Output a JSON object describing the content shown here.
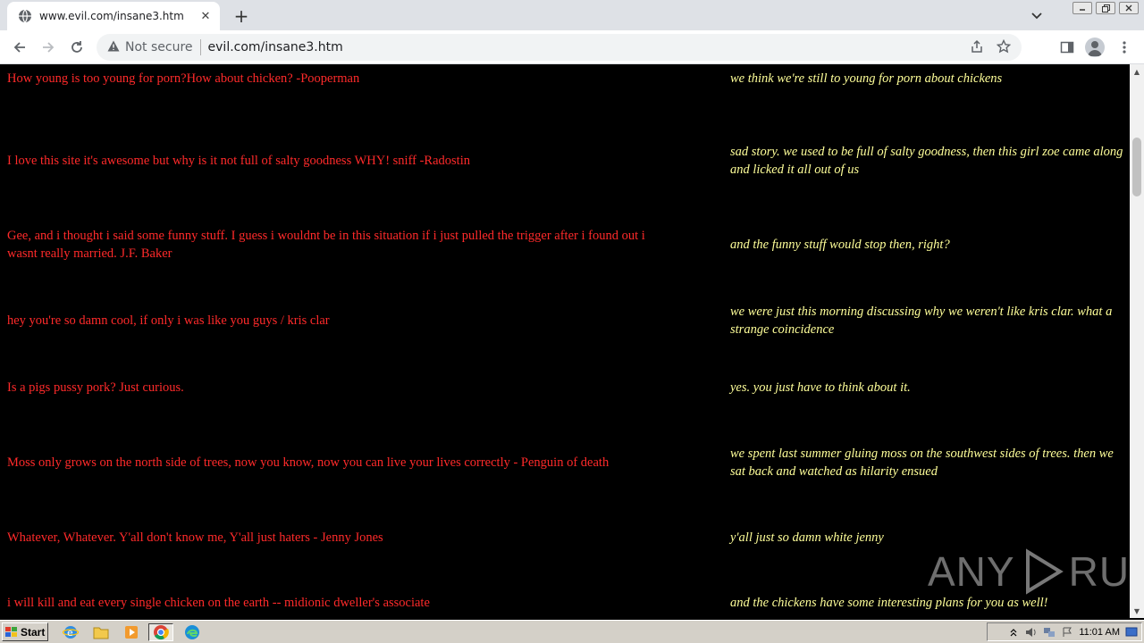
{
  "browser": {
    "tab_title": "www.evil.com/insane3.htm",
    "security_label": "Not secure",
    "url": "evil.com/insane3.htm",
    "new_tab_symbol": "+",
    "close_symbol": "✕"
  },
  "rows": [
    {
      "left": "How young is too young for porn?How about chicken? -Pooperman",
      "right": "we think we're still to young for porn about chickens"
    },
    {
      "left": "I love this site it's awesome but why is it not full of salty goodness WHY! sniff -Radostin",
      "right": "sad story.  we used to be full of salty goodness, then this girl zoe came along and licked it all out of us"
    },
    {
      "left": "Gee, and i thought i said some funny stuff. I guess i wouldnt be in this situation if i just pulled the trigger after i found out i wasnt really married. J.F. Baker",
      "right": "and the funny stuff would stop then, right?"
    },
    {
      "left": "hey you're so damn cool, if only i was like you guys / kris clar",
      "right": "we were just this morning discussing why we weren't like kris clar. what a strange coincidence"
    },
    {
      "left": "Is a pigs pussy pork? Just curious.",
      "right": "yes.  you just have to think about it."
    },
    {
      "left": "Moss only grows on the north side of trees, now you know, now you can live your lives correctly - Penguin of death",
      "right": "we spent last summer gluing moss on the southwest sides of trees. then we sat back and watched as hilarity ensued"
    },
    {
      "left": "Whatever, Whatever.  Y'all don't know me, Y'all just haters - Jenny Jones",
      "right": "y'all just so damn white jenny"
    },
    {
      "left": "i will kill and eat every single chicken on  the earth -- midionic dweller's associate",
      "right": "and the chickens have some interesting plans for you as well!"
    }
  ],
  "watermark": {
    "left": "ANY",
    "right": "RUN"
  },
  "taskbar": {
    "start_label": "Start",
    "clock": "11:01 AM"
  },
  "colors": {
    "left_text": "#ff2a2a",
    "right_text": "#ffff99",
    "page_bg": "#000000"
  }
}
